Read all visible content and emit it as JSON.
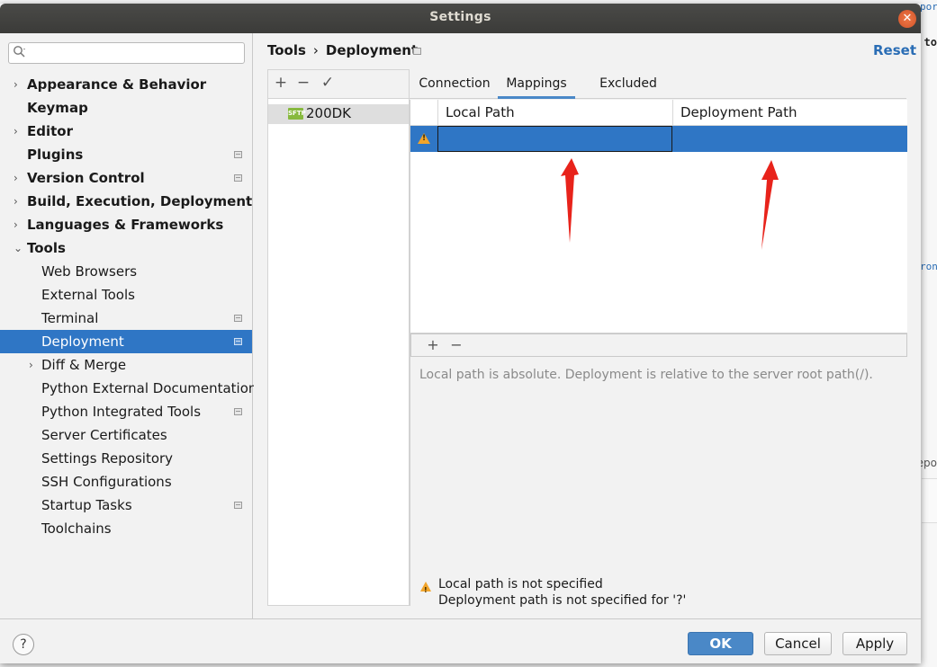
{
  "dialog": {
    "title": "Settings"
  },
  "background": {
    "right_text_top": "to",
    "right_snippet_1": "por",
    "right_snippet_2": "ron",
    "right_text_bottom": "epo"
  },
  "sidebar": {
    "search_placeholder": "",
    "items": [
      {
        "label": "Appearance & Behavior",
        "bold": true,
        "arrow": "›"
      },
      {
        "label": "Keymap",
        "bold": true,
        "arrow": ""
      },
      {
        "label": "Editor",
        "bold": true,
        "arrow": "›"
      },
      {
        "label": "Plugins",
        "bold": true,
        "arrow": ""
      },
      {
        "label": "Version Control",
        "bold": true,
        "arrow": "›"
      },
      {
        "label": "Build, Execution, Deployment",
        "bold": true,
        "arrow": "›"
      },
      {
        "label": "Languages & Frameworks",
        "bold": true,
        "arrow": "›"
      },
      {
        "label": "Tools",
        "bold": true,
        "arrow": "⌄"
      },
      {
        "label": "Web Browsers",
        "bold": false,
        "arrow": ""
      },
      {
        "label": "External Tools",
        "bold": false,
        "arrow": ""
      },
      {
        "label": "Terminal",
        "bold": false,
        "arrow": ""
      },
      {
        "label": "Deployment",
        "bold": false,
        "arrow": ""
      },
      {
        "label": "Diff & Merge",
        "bold": false,
        "arrow": "›"
      },
      {
        "label": "Python External Documentation",
        "bold": false,
        "arrow": ""
      },
      {
        "label": "Python Integrated Tools",
        "bold": false,
        "arrow": ""
      },
      {
        "label": "Server Certificates",
        "bold": false,
        "arrow": ""
      },
      {
        "label": "Settings Repository",
        "bold": false,
        "arrow": ""
      },
      {
        "label": "SSH Configurations",
        "bold": false,
        "arrow": ""
      },
      {
        "label": "Startup Tasks",
        "bold": false,
        "arrow": ""
      },
      {
        "label": "Toolchains",
        "bold": false,
        "arrow": ""
      }
    ]
  },
  "content": {
    "breadcrumb": [
      "Tools",
      "Deployment"
    ],
    "breadcrumb_sep": "›",
    "reset_label": "Reset",
    "toolbar": {
      "add": "+",
      "remove": "−",
      "apply": "✓"
    },
    "server": {
      "icon_text": "SFTP",
      "name": "200DK"
    },
    "tabs": [
      "Connection",
      "Mappings",
      "Excluded Paths"
    ],
    "active_tab": "Mappings",
    "table": {
      "headers": [
        "Local Path",
        "Deployment Path"
      ],
      "row": {
        "local_path": "",
        "deployment_path": ""
      }
    },
    "map_toolbar": {
      "add": "+",
      "remove": "−"
    },
    "hint": "Local path is absolute. Deployment is relative to the server root path(/).",
    "errors": [
      "Local path is not specified",
      "Deployment path is not specified for '?'"
    ]
  },
  "footer": {
    "help": "?",
    "ok": "OK",
    "cancel": "Cancel",
    "apply": "Apply"
  },
  "colors": {
    "selection": "#2f76c5",
    "link": "#2a6db5",
    "warning": "#f2a52b",
    "annotation": "#e8231b",
    "sftp": "#87b93e"
  }
}
